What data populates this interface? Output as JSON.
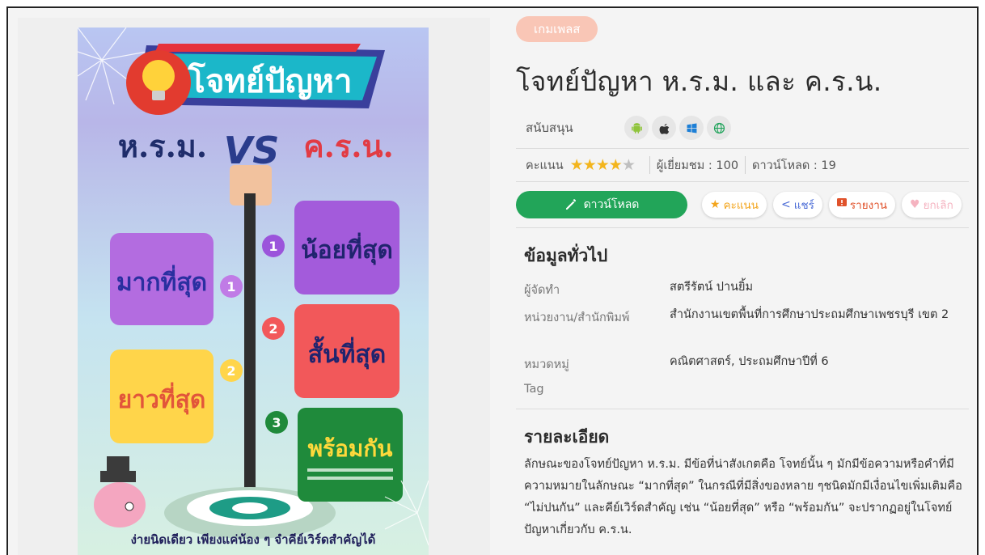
{
  "badge": "เกมเพลส",
  "title": "โจทย์ปัญหา ห.ร.ม. และ ค.ร.น.",
  "support": {
    "label": "สนับสนุน",
    "platforms": [
      "android-icon",
      "apple-icon",
      "windows-icon",
      "web-icon"
    ]
  },
  "stats": {
    "rating_label": "คะแนน",
    "rating": 4,
    "rating_max": 5,
    "views": "ผู้เยี่ยมชม : 100",
    "downloads": "ดาวน์โหลด : 19"
  },
  "actions": {
    "download": "ดาวน์โหลด",
    "rate": "คะแนน",
    "share": "แชร์",
    "report": "รายงาน",
    "unfavorite": "ยกเลิก"
  },
  "general": {
    "heading": "ข้อมูลทั่วไป",
    "rows": [
      {
        "key": "ผู้จัดทำ",
        "value": "สตรีรัตน์ ปานยิ้ม"
      },
      {
        "key": "หน่วยงาน/สำนักพิมพ์",
        "value": "สำนักงานเขตพื้นที่การศึกษาประถมศึกษาเพชรบุรี เขต 2"
      },
      {
        "key": "หมวดหมู่",
        "value": "คณิตศาสตร์, ประถมศึกษาปีที่ 6"
      },
      {
        "key": "Tag",
        "value": ""
      }
    ]
  },
  "details": {
    "heading": "รายละเอียด",
    "text": "ลักษณะของโจทย์ปัญหา ห.ร.ม. มีข้อที่น่าสังเกตคือ โจทย์นั้น ๆ มักมีข้อความหรือคำที่มีความหมายในลักษณะ “มากที่สุด” ในกรณีที่มีสิ่งของหลาย ๆชนิดมักมีเงื่อนไขเพิ่มเติมคือ “ไม่ปนกัน” และคีย์เวิร์ดสำคัญ เช่น “น้อยที่สุด” หรือ “พร้อมกัน” จะปรากฏอยู่ในโจทย์ปัญหาเกี่ยวกับ ค.ร.น."
  },
  "poster": {
    "title": "โจทย์ปัญหา",
    "left_label": "ห.ร.ม.",
    "vs": "VS",
    "right_label": "ค.ร.น.",
    "left_items": [
      {
        "num": "1",
        "text": "มากที่สุด",
        "color": "#b36ce0"
      },
      {
        "num": "2",
        "text": "ยาวที่สุด",
        "color": "#ffd54a"
      }
    ],
    "right_items": [
      {
        "num": "1",
        "text": "น้อยที่สุด",
        "color": "#a35bdb"
      },
      {
        "num": "2",
        "text": "สั้นที่สุด",
        "color": "#f2585a"
      },
      {
        "num": "3",
        "text": "พร้อมกัน",
        "color": "#1f8a3b"
      }
    ],
    "footer": "ง่ายนิดเดียว เพียงแค่น้อง ๆ จำคีย์เวิร์ดสำคัญได้"
  }
}
